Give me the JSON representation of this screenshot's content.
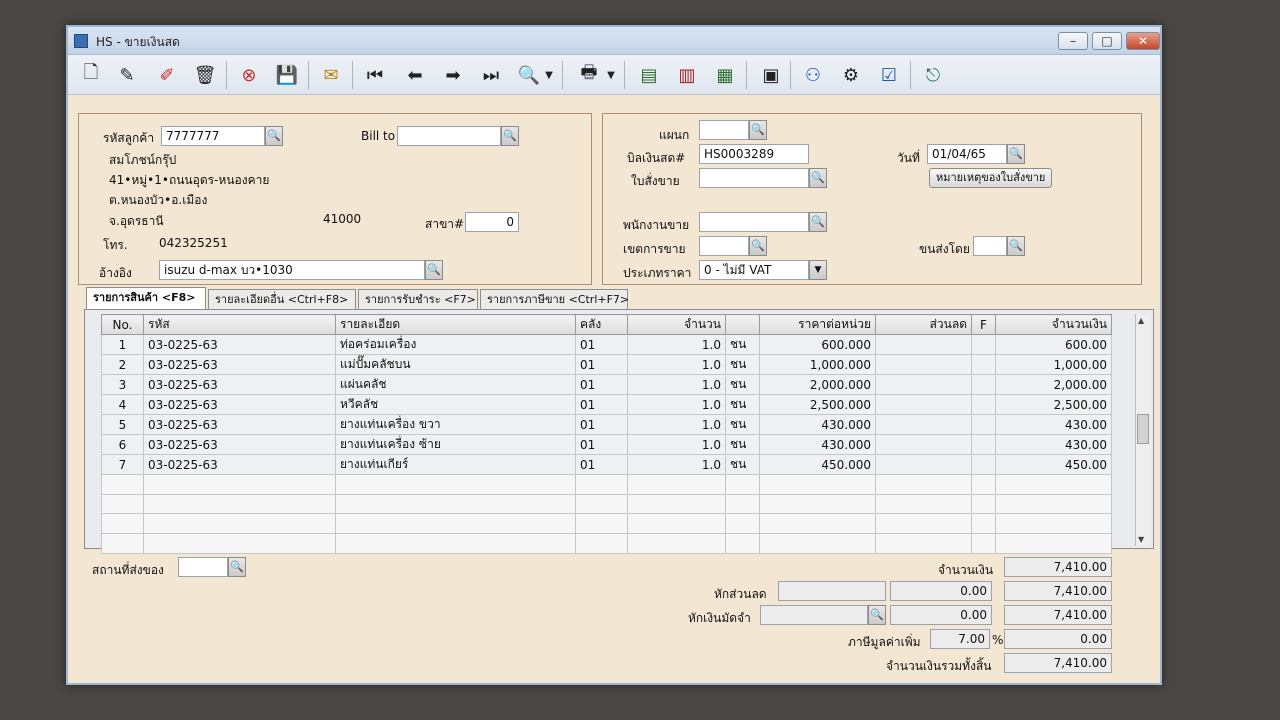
{
  "window": {
    "title": "HS - ขายเงินสด"
  },
  "toolbar": {
    "icons": [
      "new-doc-icon",
      "edit-icon",
      "edit-red-icon",
      "delete-icon",
      "cancel-icon",
      "save-icon",
      "approve-icon",
      "first-icon",
      "prev-icon",
      "next-icon",
      "last-icon",
      "search-doc-icon",
      "print-icon",
      "report1-icon",
      "report2-icon",
      "report3-icon",
      "calc-icon",
      "ok-user-icon",
      "tools-icon",
      "ok-icon",
      "exit-icon"
    ]
  },
  "customer": {
    "code_label": "รหัสลูกค้า",
    "code": "7777777",
    "bill_to_label": "Bill to",
    "bill_to": "",
    "name": "สมโภชน์กรุ๊ป",
    "address1": "41•หมู่•1•ถนนอุดร-หนองคาย",
    "address2": "ต.หนองบัว•อ.เมือง",
    "province": "จ.อุดรธานี",
    "zip": "41000",
    "branch_label": "สาขา#",
    "branch": "0",
    "phone_label": "โทร.",
    "phone": "042325251",
    "ref_label": "อ้างอิง",
    "ref": "isuzu d-max บว•1030"
  },
  "doc": {
    "dept_label": "แผนก",
    "dept": "",
    "bill_label": "บิลเงินสด#",
    "bill": "HS0003289",
    "date_label": "วันที่",
    "date": "01/04/65",
    "so_label": "ใบสั่งขาย",
    "so": "",
    "so_note_button": "หมายเหตุของใบสั่งขาย",
    "salesman_label": "พนักงานขาย",
    "salesman": "",
    "area_label": "เขตการขาย",
    "area": "",
    "ship_by_label": "ขนส่งโดย",
    "ship_by": "",
    "price_type_label": "ประเภทราคา",
    "price_type": "0 - ไม่มี VAT"
  },
  "tabs": [
    {
      "label": "รายการสินค้า <F8>"
    },
    {
      "label": "รายละเอียดอื่น <Ctrl+F8>"
    },
    {
      "label": "รายการรับชำระ <F7>"
    },
    {
      "label": "รายการภาษีขาย <Ctrl+F7>"
    }
  ],
  "grid": {
    "headers": [
      "No.",
      "รหัส",
      "รายละเอียด",
      "คลัง",
      "จำนวน",
      "",
      "ราคาต่อหน่วย",
      "ส่วนลด",
      "F",
      "จำนวนเงิน"
    ],
    "rows": [
      {
        "no": "1",
        "code": "03-0225-63",
        "desc": "ท่อคร่อมเครื่อง",
        "wh": "01",
        "qty": "1.0",
        "unit": "ชน",
        "price": "600.000",
        "disc": "",
        "f": "",
        "amount": "600.00"
      },
      {
        "no": "2",
        "code": "03-0225-63",
        "desc": "แม่ปั๊มคลัชบน",
        "wh": "01",
        "qty": "1.0",
        "unit": "ชน",
        "price": "1,000.000",
        "disc": "",
        "f": "",
        "amount": "1,000.00"
      },
      {
        "no": "3",
        "code": "03-0225-63",
        "desc": "แผ่นคลัช",
        "wh": "01",
        "qty": "1.0",
        "unit": "ชน",
        "price": "2,000.000",
        "disc": "",
        "f": "",
        "amount": "2,000.00"
      },
      {
        "no": "4",
        "code": "03-0225-63",
        "desc": "หวีคลัช",
        "wh": "01",
        "qty": "1.0",
        "unit": "ชน",
        "price": "2,500.000",
        "disc": "",
        "f": "",
        "amount": "2,500.00"
      },
      {
        "no": "5",
        "code": "03-0225-63",
        "desc": "ยางแท่นเครื่อง  ขวา",
        "wh": "01",
        "qty": "1.0",
        "unit": "ชน",
        "price": "430.000",
        "disc": "",
        "f": "",
        "amount": "430.00"
      },
      {
        "no": "6",
        "code": "03-0225-63",
        "desc": "ยางแท่นเครื่อง  ซ้าย",
        "wh": "01",
        "qty": "1.0",
        "unit": "ชน",
        "price": "430.000",
        "disc": "",
        "f": "",
        "amount": "430.00"
      },
      {
        "no": "7",
        "code": "03-0225-63",
        "desc": "ยางแท่นเกียร์",
        "wh": "01",
        "qty": "1.0",
        "unit": "ชน",
        "price": "450.000",
        "disc": "",
        "f": "",
        "amount": "450.00"
      }
    ],
    "empty_rows": 4
  },
  "footer": {
    "ship_place_label": "สถานที่ส่งของ",
    "ship_place": "",
    "amount_label": "จำนวนเงิน",
    "amount": "7,410.00",
    "discount_label": "หักส่วนลด",
    "discount_text": "",
    "discount_value": "0.00",
    "after_discount": "7,410.00",
    "deposit_label": "หักเงินมัดจำ",
    "deposit_text": "",
    "deposit_value": "0.00",
    "after_deposit": "7,410.00",
    "vat_label": "ภาษีมูลค่าเพิ่ม",
    "vat_rate": "7.00",
    "vat_unit": "%",
    "vat_value": "0.00",
    "total_label": "จำนวนเงินรวมทั้งสิ้น",
    "total": "7,410.00"
  }
}
